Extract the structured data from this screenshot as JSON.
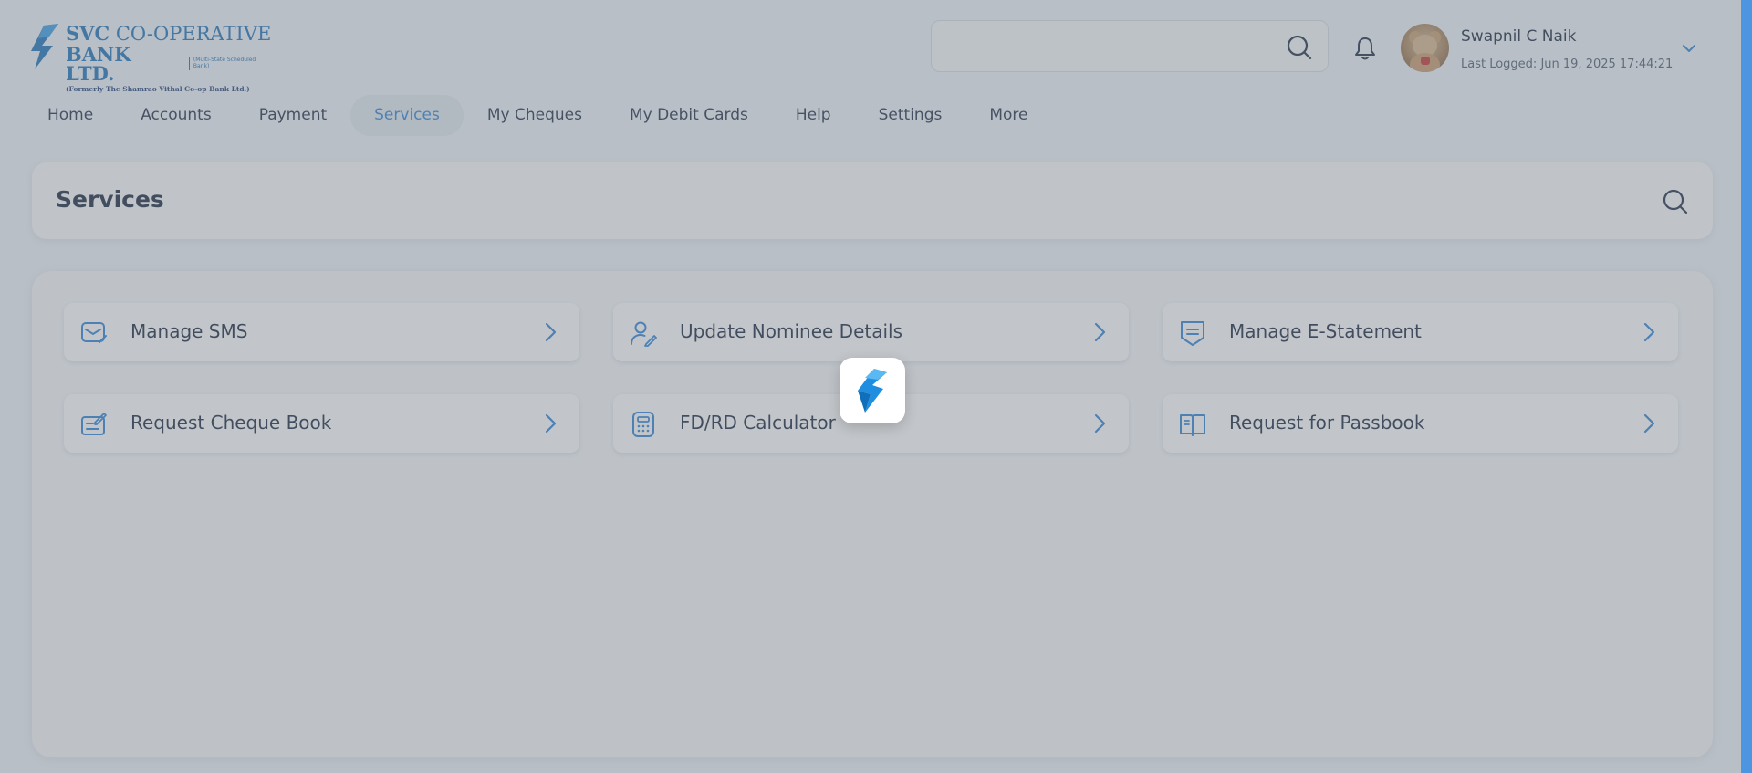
{
  "brand": {
    "line1_bold": "SVC",
    "line1_rest": " CO-OPERATIVE",
    "line2": "BANK LTD.",
    "line2_tag": "(Multi-State Scheduled Bank)",
    "line3": "(Formerly The Shamrao Vithal Co-op Bank Ltd.)",
    "accent": "#1d6fb8"
  },
  "header": {
    "search_placeholder": "",
    "user_name": "Swapnil C Naik",
    "last_logged": "Last Logged: Jun 19, 2025 17:44:21"
  },
  "nav": {
    "items": [
      {
        "label": "Home"
      },
      {
        "label": "Accounts"
      },
      {
        "label": "Payment"
      },
      {
        "label": "Services",
        "active": true
      },
      {
        "label": "My Cheques"
      },
      {
        "label": "My Debit Cards"
      },
      {
        "label": "Help"
      },
      {
        "label": "Settings"
      },
      {
        "label": "More"
      }
    ]
  },
  "page": {
    "title": "Services"
  },
  "services": [
    {
      "label": "Manage SMS",
      "icon": "sms-envelope-icon"
    },
    {
      "label": "Update Nominee Details",
      "icon": "user-edit-icon"
    },
    {
      "label": "Manage E-Statement",
      "icon": "statement-icon"
    },
    {
      "label": "Request Cheque Book",
      "icon": "cheque-book-icon"
    },
    {
      "label": "FD/RD Calculator",
      "icon": "calculator-icon"
    },
    {
      "label": "Request for Passbook",
      "icon": "passbook-icon"
    }
  ],
  "colors": {
    "accent": "#2c82d6",
    "text_dark": "#17253c",
    "overlay": "rgba(120,128,138,0.45)"
  }
}
